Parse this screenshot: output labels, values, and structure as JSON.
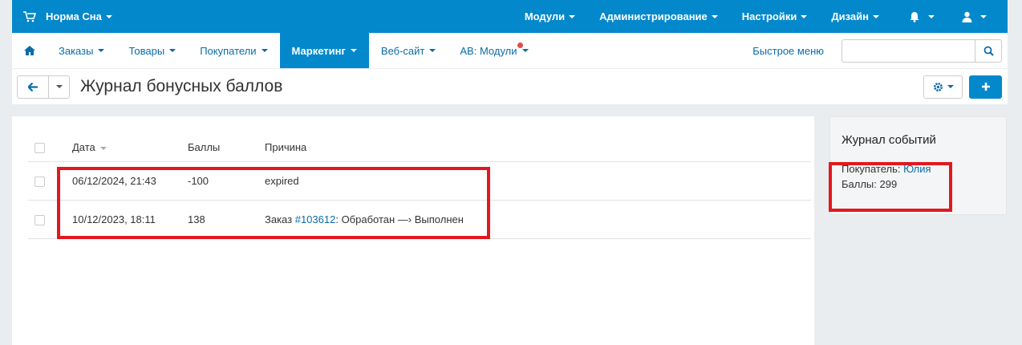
{
  "topbar": {
    "store_name": "Норма Сна",
    "menus": [
      "Модули",
      "Администрирование",
      "Настройки",
      "Дизайн"
    ]
  },
  "nav": {
    "items": [
      {
        "label": "Заказы",
        "active": false
      },
      {
        "label": "Товары",
        "active": false
      },
      {
        "label": "Покупатели",
        "active": false
      },
      {
        "label": "Маркетинг",
        "active": true
      },
      {
        "label": "Веб-сайт",
        "active": false
      },
      {
        "label": "АВ: Модули",
        "active": false
      }
    ],
    "quick_menu": "Быстрое меню",
    "search_value": ""
  },
  "page": {
    "title": "Журнал бонусных баллов"
  },
  "table": {
    "headers": {
      "date": "Дата",
      "points": "Баллы",
      "reason": "Причина"
    },
    "rows": [
      {
        "date": "06/12/2024, 21:43",
        "points": "-100",
        "reason_text": "expired",
        "reason_prefix": "",
        "order_link": "",
        "reason_suffix": ""
      },
      {
        "date": "10/12/2023, 18:11",
        "points": "138",
        "reason_text": "",
        "reason_prefix": "Заказ ",
        "order_link": "#103612",
        "reason_suffix": ": Обработан —› Выполнен"
      }
    ]
  },
  "sidebar": {
    "title": "Журнал событий",
    "customer_label": "Покупатель: ",
    "customer_name": "Юлия",
    "points_line": "Баллы: 299"
  },
  "colors": {
    "primary": "#0388cc",
    "link": "#0a6ca8",
    "highlight": "#e1191f"
  }
}
